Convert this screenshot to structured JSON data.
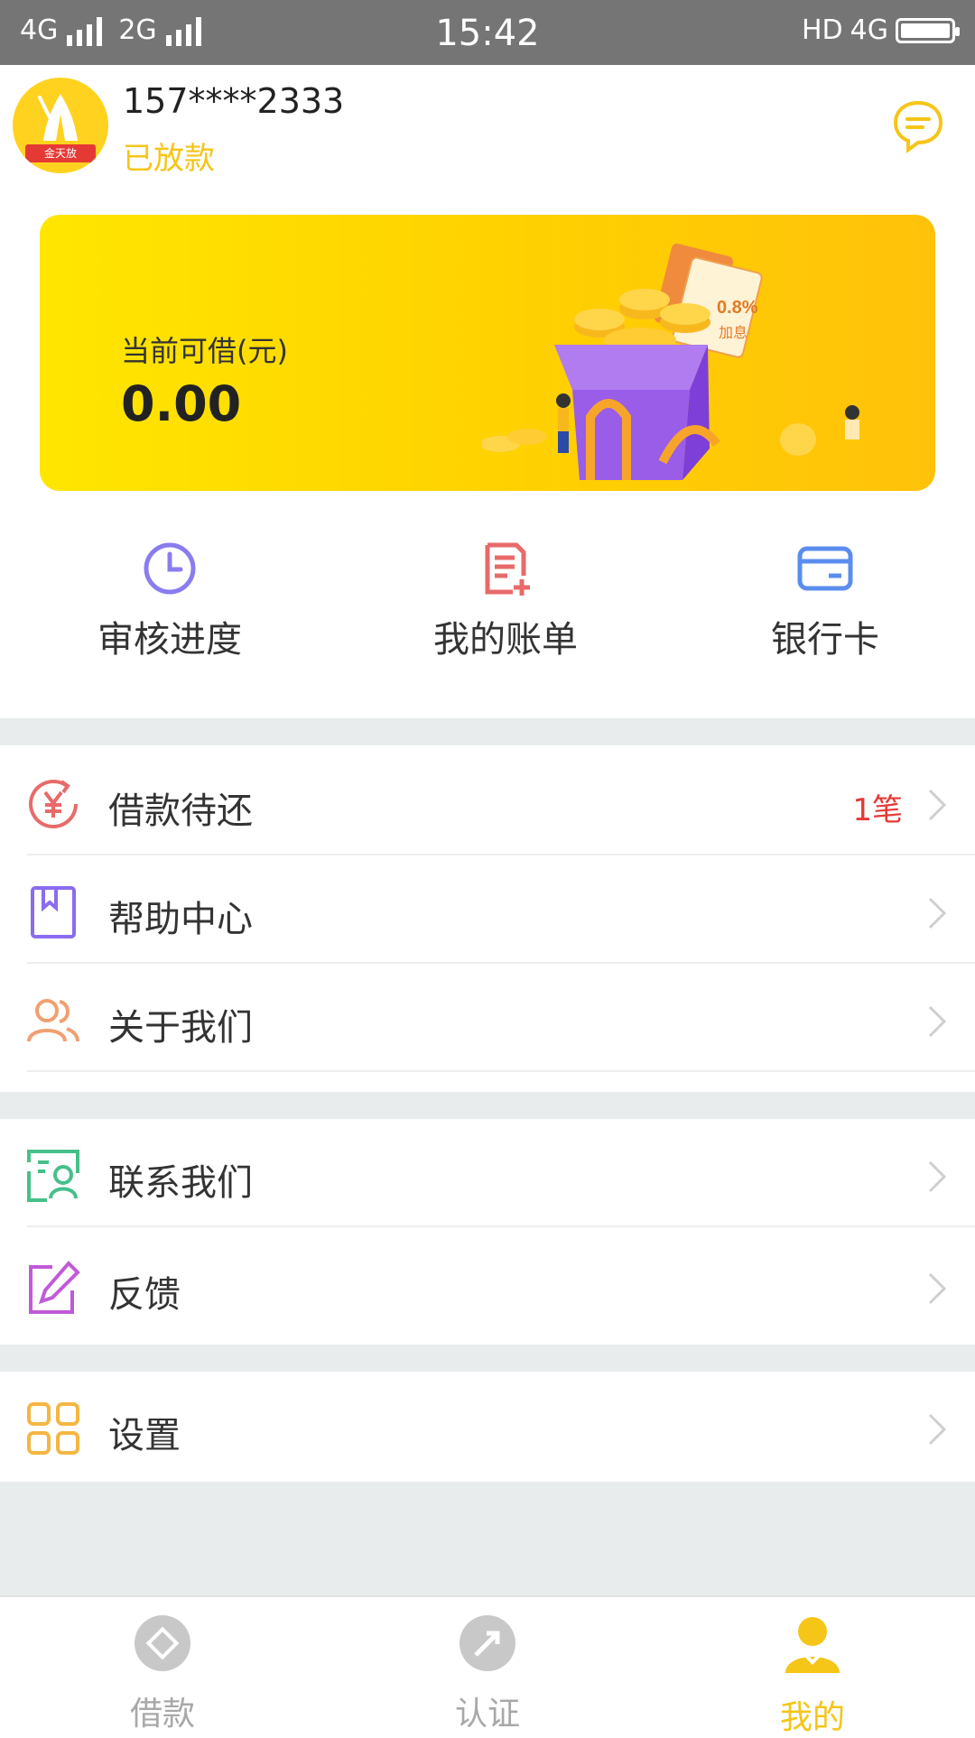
{
  "statusbar": {
    "net1": "4G",
    "net2": "2G",
    "time": "15:42",
    "right_hd": "HD",
    "right_net": "4G"
  },
  "profile": {
    "phone": "157****2333",
    "status": "已放款",
    "avatar_ribbon": "金天放"
  },
  "banner": {
    "label": "当前可借(元)",
    "amount": "0.00",
    "ticket_rate": "0.8%",
    "ticket_note": "加息"
  },
  "quick_actions": [
    {
      "label": "审核进度",
      "icon": "clock-icon",
      "color": "#8a7cf0"
    },
    {
      "label": "我的账单",
      "icon": "bill-icon",
      "color": "#e86a6a"
    },
    {
      "label": "银行卡",
      "icon": "card-icon",
      "color": "#5b8def"
    }
  ],
  "menu": [
    {
      "label": "借款待还",
      "icon": "yen-refresh-icon",
      "badge": "1笔"
    },
    {
      "label": "帮助中心",
      "icon": "book-icon"
    },
    {
      "label": "关于我们",
      "icon": "users-icon"
    },
    {
      "label": "联系我们",
      "icon": "contact-icon"
    },
    {
      "label": "反馈",
      "icon": "edit-icon"
    },
    {
      "label": "设置",
      "icon": "grid-icon"
    }
  ],
  "tabs": [
    {
      "label": "借款",
      "icon": "loan-icon"
    },
    {
      "label": "认证",
      "icon": "verify-icon"
    },
    {
      "label": "我的",
      "icon": "user-icon",
      "active": true
    }
  ],
  "colors": {
    "accent": "#f5c518",
    "badge": "#e53935",
    "statusbar": "#757575",
    "separator": "#e8ecec"
  }
}
